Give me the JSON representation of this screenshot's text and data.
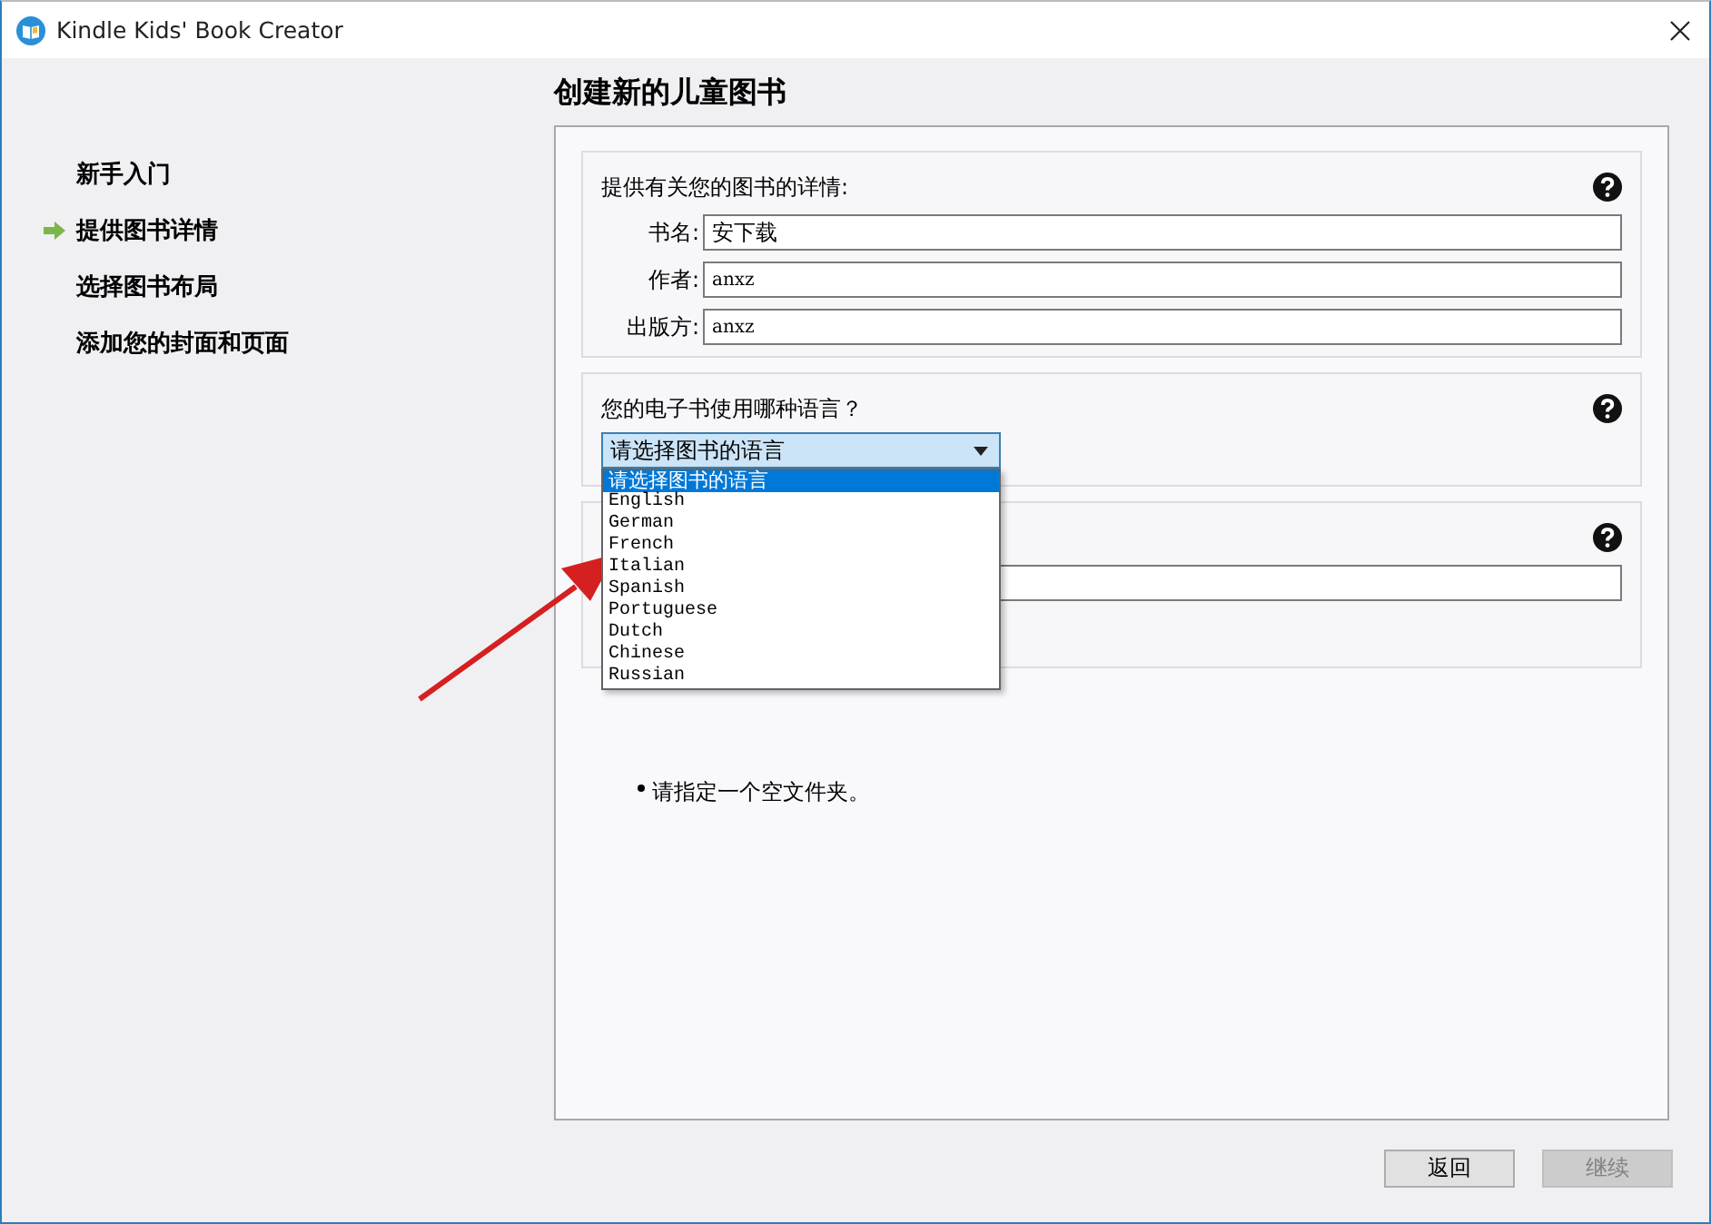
{
  "window": {
    "title": "Kindle Kids' Book Creator"
  },
  "sidebar": {
    "items": [
      {
        "label": "新手入门",
        "selected": false
      },
      {
        "label": "提供图书详情",
        "selected": true
      },
      {
        "label": "选择图书布局",
        "selected": false
      },
      {
        "label": "添加您的封面和页面",
        "selected": false
      }
    ]
  },
  "main": {
    "heading": "创建新的儿童图书",
    "details": {
      "heading": "提供有关您的图书的详情:",
      "fields": [
        {
          "label": "书名:",
          "value": "安下载"
        },
        {
          "label": "作者:",
          "value": "anxz"
        },
        {
          "label": "出版方:",
          "value": "anxz"
        }
      ]
    },
    "language": {
      "question": "您的电子书使用哪种语言？",
      "select": {
        "value": "请选择图书的语言",
        "expanded": true,
        "options": [
          {
            "label": "请选择图书的语言",
            "selected": true
          },
          {
            "label": "English",
            "selected": false
          },
          {
            "label": "German",
            "selected": false
          },
          {
            "label": "French",
            "selected": false
          },
          {
            "label": "Italian",
            "selected": false
          },
          {
            "label": "Spanish",
            "selected": false
          },
          {
            "label": "Portuguese",
            "selected": false
          },
          {
            "label": "Dutch",
            "selected": false
          },
          {
            "label": "Chinese",
            "selected": false
          },
          {
            "label": "Russian",
            "selected": false
          }
        ]
      }
    },
    "folder": {
      "note": "请指定一个空文件夹。"
    }
  },
  "buttons": [
    {
      "label": "返回",
      "disabled": false
    },
    {
      "label": "继续",
      "disabled": true
    }
  ]
}
